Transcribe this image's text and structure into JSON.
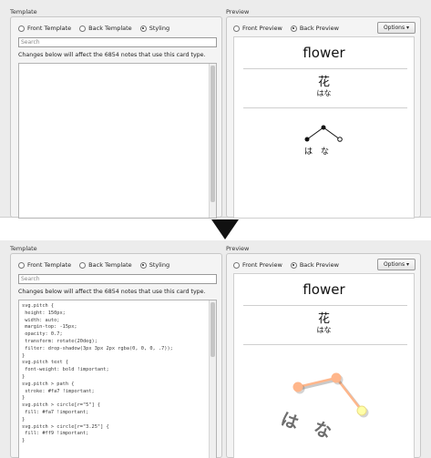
{
  "template_group_title": "Template",
  "preview_group_title": "Preview",
  "tabs": [
    {
      "label": "Front Template",
      "selected": false
    },
    {
      "label": "Back Template",
      "selected": false
    },
    {
      "label": "Styling",
      "selected": true
    }
  ],
  "search_placeholder": "Search",
  "info_text": "Changes below will affect the 6854 notes that use this card type.",
  "preview_tabs": [
    {
      "label": "Front Preview",
      "selected": false
    },
    {
      "label": "Back Preview",
      "selected": true
    }
  ],
  "options_label": "Options ▾",
  "card": {
    "front": "flower",
    "kanji": "花",
    "reading": "はな",
    "pitch_mora": [
      "は",
      "な"
    ]
  },
  "styling_code": [
    "svg.pitch {",
    " height: 150px;",
    " width: auto;",
    " margin-top: -15px;",
    " opacity: 0.7;",
    " transform: rotate(20deg);",
    " filter: drop-shadow(3px 3px 2px rgba(0, 0, 0, .7));",
    "}",
    "svg.pitch text {",
    " font-weight: bold !important;",
    "}",
    "svg.pitch > path {",
    " stroke: #fa7 !important;",
    "}",
    "svg.pitch > circle[r=\"5\"] {",
    " fill: #fa7 !important;",
    "}",
    "svg.pitch > circle[r=\"3.25\"] {",
    " fill: #ff9 !important;",
    "}"
  ],
  "colors": {
    "pitch_line": "#ffaa77",
    "pitch_dot": "#ffaa77",
    "pitch_end_dot": "#ffff99"
  }
}
